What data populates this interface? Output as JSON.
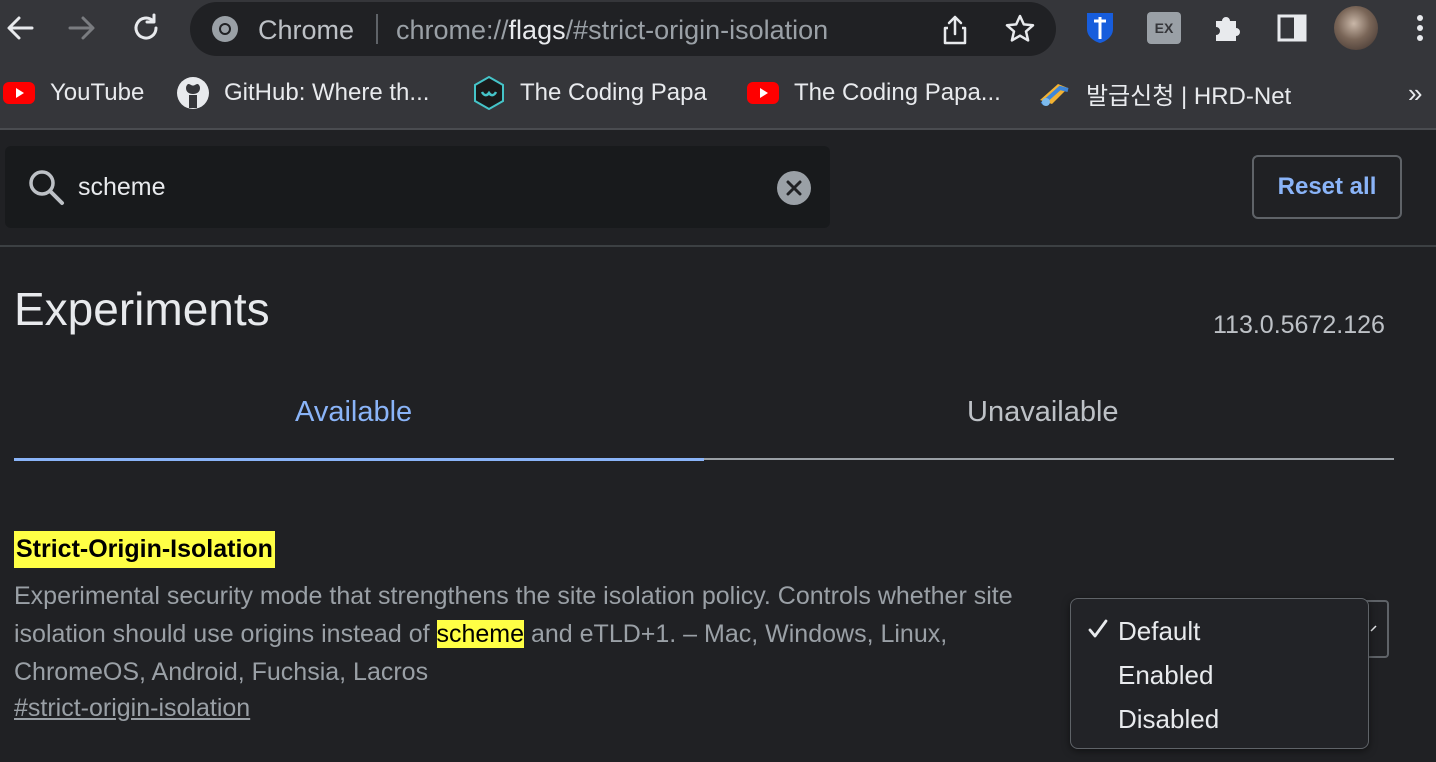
{
  "toolbar": {
    "app_name": "Chrome",
    "url_prefix": "chrome://",
    "url_bold": "flags",
    "url_suffix": "/#strict-origin-isolation",
    "icons": [
      "back-arrow-icon",
      "forward-arrow-icon",
      "reload-icon",
      "chrome-logo-icon",
      "share-icon",
      "star-icon",
      "bitwarden-icon",
      "extension-ex-icon",
      "puzzle-icon",
      "side-panel-icon",
      "profile-avatar",
      "more-vert-icon"
    ]
  },
  "bookmarks": [
    {
      "label": "YouTube",
      "icon": "youtube-icon"
    },
    {
      "label": "GitHub: Where th...",
      "icon": "github-icon"
    },
    {
      "label": "The Coding Papa",
      "icon": "coding-papa-icon"
    },
    {
      "label": "The Coding Papa...",
      "icon": "youtube-icon"
    },
    {
      "label": "발급신청 | HRD-Net",
      "icon": "hrd-net-icon"
    }
  ],
  "bookmarks_overflow": "»",
  "search": {
    "value": "scheme"
  },
  "reset_label": "Reset all",
  "page_title": "Experiments",
  "version": "113.0.5672.126",
  "tabs": [
    {
      "label": "Available",
      "active": true
    },
    {
      "label": "Unavailable",
      "active": false
    }
  ],
  "flag": {
    "title": "Strict-Origin-Isolation",
    "desc_part1": "Experimental security mode that strengthens the site isolation policy. Controls whether site isolation should use origins instead of ",
    "desc_highlight": "scheme",
    "desc_part2": " and eTLD+1. – Mac, Windows, Linux, ChromeOS, Android, Fuchsia, Lacros",
    "link": "#strict-origin-isolation"
  },
  "dropdown": {
    "selected": "Default",
    "options": [
      "Default",
      "Enabled",
      "Disabled"
    ]
  },
  "colors": {
    "accent": "#8ab4f8",
    "highlight": "#ffff45",
    "background": "#202124",
    "toolbar": "#35363a"
  }
}
